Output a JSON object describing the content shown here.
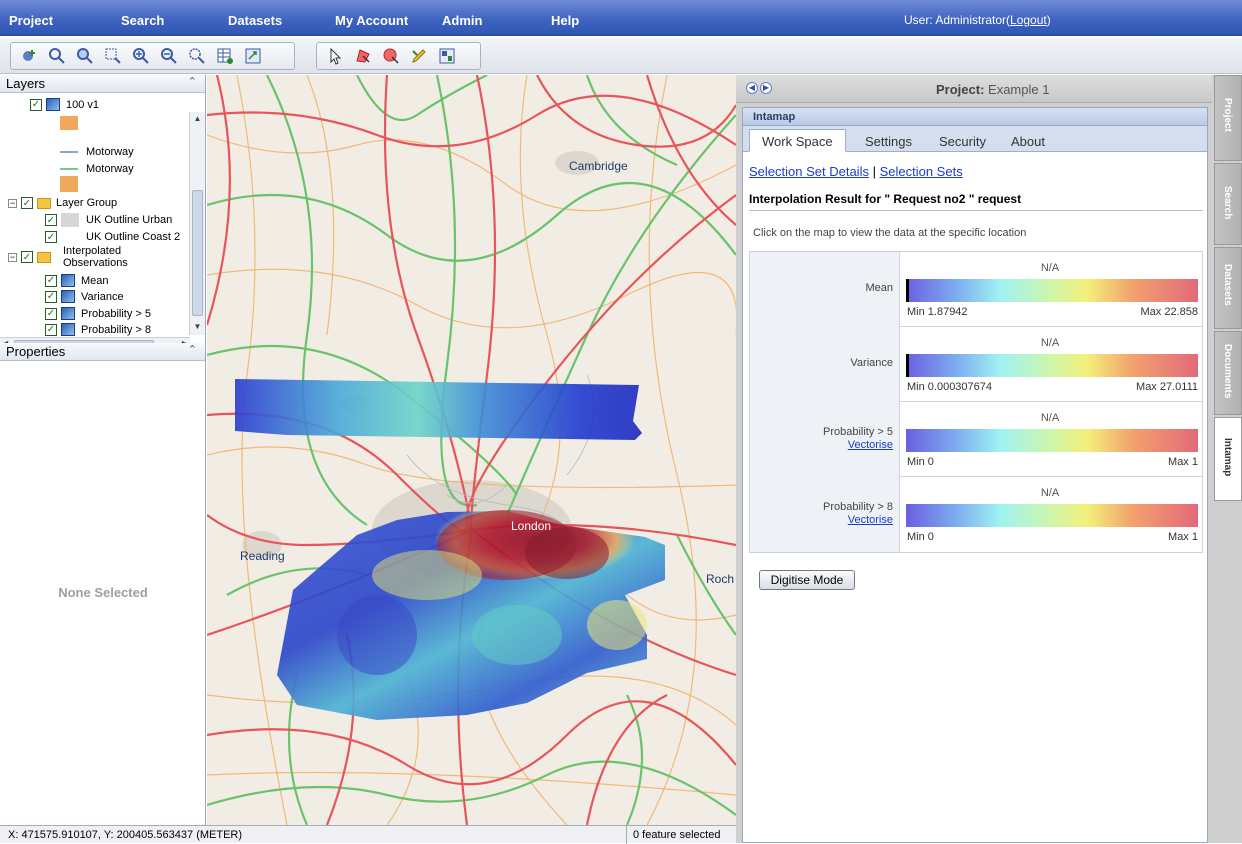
{
  "menu": {
    "project": "Project",
    "search": "Search",
    "datasets": "Datasets",
    "my_account": "My Account",
    "admin": "Admin",
    "help": "Help"
  },
  "user": {
    "prefix": "User: Administrator(",
    "logout": "Logout",
    "suffix": ")"
  },
  "layers": {
    "title": "Layers",
    "items": {
      "v100": "100 v1",
      "motorway1": "Motorway",
      "motorway2": "Motorway",
      "layer_group": "Layer Group",
      "uk_urban": "UK Outline Urban",
      "uk_coast": "UK Outline Coast 2",
      "interp_line1": "Interpolated",
      "interp_line2": "Observations",
      "mean": "Mean",
      "variance": "Variance",
      "prob5": "Probability > 5",
      "prob8": "Probability > 8"
    }
  },
  "properties": {
    "title": "Properties",
    "empty": "None Selected"
  },
  "map_labels": {
    "cambridge": "Cambridge",
    "london": "London",
    "reading": "Reading",
    "roch": "Roch"
  },
  "status": {
    "coords": "X: 471575.910107, Y: 200405.563437 (METER)",
    "features": "0 feature selected"
  },
  "project": {
    "label": "Project:",
    "name": "Example 1"
  },
  "panel": {
    "title": "Intamap",
    "tabs": {
      "workspace": "Work Space",
      "settings": "Settings",
      "security": "Security",
      "about": "About"
    },
    "links": {
      "details": "Selection Set Details",
      "sep": "|",
      "sets": "Selection Sets"
    },
    "result_title": "Interpolation Result for \" Request no2 \" request",
    "hint": "Click on the map to view the data at the specific location",
    "rows": [
      {
        "label": "Mean",
        "value": "N/A",
        "min": "Min 1.87942",
        "max": "Max 22.858"
      },
      {
        "label": "Variance",
        "value": "N/A",
        "min": "Min 0.000307674",
        "max": "Max 27.0111"
      },
      {
        "label": "Probability > 5",
        "link": "Vectorise",
        "value": "N/A",
        "min": "Min 0",
        "max": "Max 1"
      },
      {
        "label": "Probability > 8",
        "link": "Vectorise",
        "value": "N/A",
        "min": "Min 0",
        "max": "Max 1"
      }
    ],
    "digitise": "Digitise Mode"
  },
  "side_tabs": {
    "project": "Project",
    "search": "Search",
    "datasets": "Datasets",
    "documents": "Documents",
    "intamap": "Intamap"
  },
  "colors": {
    "menubar": "#3d62bf",
    "major_road": "#e8545a",
    "minor_road": "#69c36b",
    "secondary_road": "#f2b36d",
    "link": "#1a3ccc"
  }
}
